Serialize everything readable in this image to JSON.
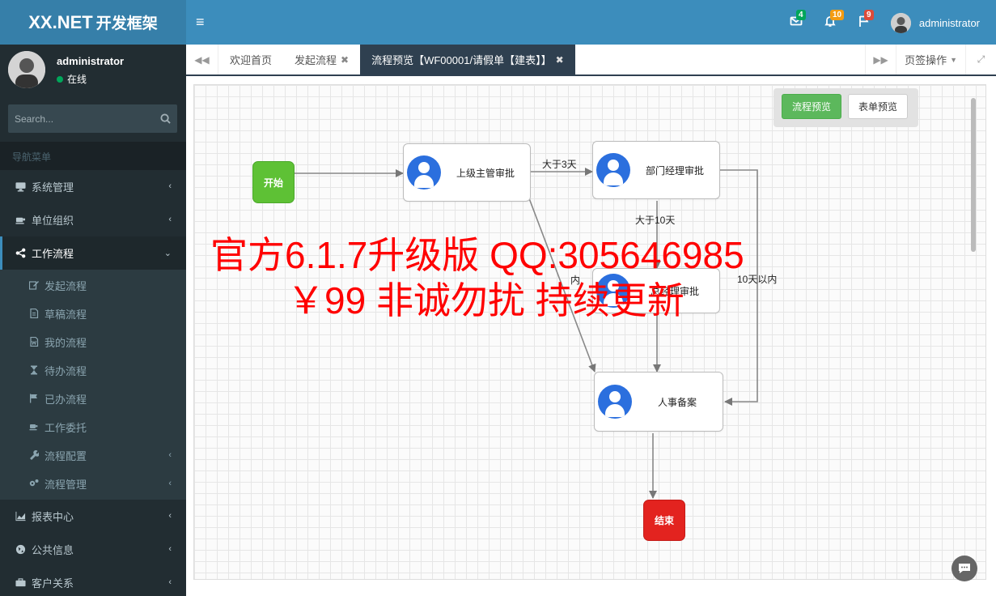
{
  "brand": {
    "title": "XX.NET",
    "subtitle": "开发框架"
  },
  "topbar": {
    "menu_icon": "hamburger-icon",
    "mail_count": "4",
    "bell_count": "10",
    "flag_count": "9",
    "username": "administrator",
    "colors": {
      "mail": "#00a65a",
      "bell": "#f39c12",
      "flag": "#dd4b39"
    }
  },
  "sidebar": {
    "user": {
      "name": "administrator",
      "status": "在线"
    },
    "search_placeholder": "Search...",
    "nav_header": "导航菜单",
    "items": [
      {
        "label": "系统管理",
        "icon": "desktop-icon"
      },
      {
        "label": "单位组织",
        "icon": "coffee-icon"
      },
      {
        "label": "工作流程",
        "icon": "share-icon"
      },
      {
        "label": "报表中心",
        "icon": "area-chart-icon"
      },
      {
        "label": "公共信息",
        "icon": "globe-icon"
      },
      {
        "label": "客户关系",
        "icon": "briefcase-icon"
      }
    ],
    "sub_items": [
      {
        "label": "发起流程",
        "icon": "edit-icon"
      },
      {
        "label": "草稿流程",
        "icon": "file-icon"
      },
      {
        "label": "我的流程",
        "icon": "file-word-icon"
      },
      {
        "label": "待办流程",
        "icon": "hourglass-icon"
      },
      {
        "label": "已办流程",
        "icon": "flag-icon"
      },
      {
        "label": "工作委托",
        "icon": "coffee-icon"
      },
      {
        "label": "流程配置",
        "icon": "wrench-icon"
      },
      {
        "label": "流程管理",
        "icon": "cogs-icon"
      }
    ]
  },
  "tabs": {
    "items": [
      {
        "label": "欢迎首页"
      },
      {
        "label": "发起流程"
      },
      {
        "label": "流程预览【WF00001/请假单【建表】】"
      }
    ],
    "page_ops": "页签操作"
  },
  "preview": {
    "flow_btn": "流程预览",
    "form_btn": "表单预览"
  },
  "flow": {
    "start": "开始",
    "end": "结束",
    "nodes": {
      "n1": "上级主管审批",
      "n2": "部门经理审批",
      "n3": "总经理审批",
      "n4": "人事备案"
    },
    "edges": {
      "e1": "大于3天",
      "e2": "大于10天",
      "e3": "10天以内",
      "e4": "内"
    }
  },
  "watermark": {
    "line1": "官方6.1.7升级版 QQ:305646985",
    "line2": "￥99 非诚勿扰  持续更新"
  }
}
